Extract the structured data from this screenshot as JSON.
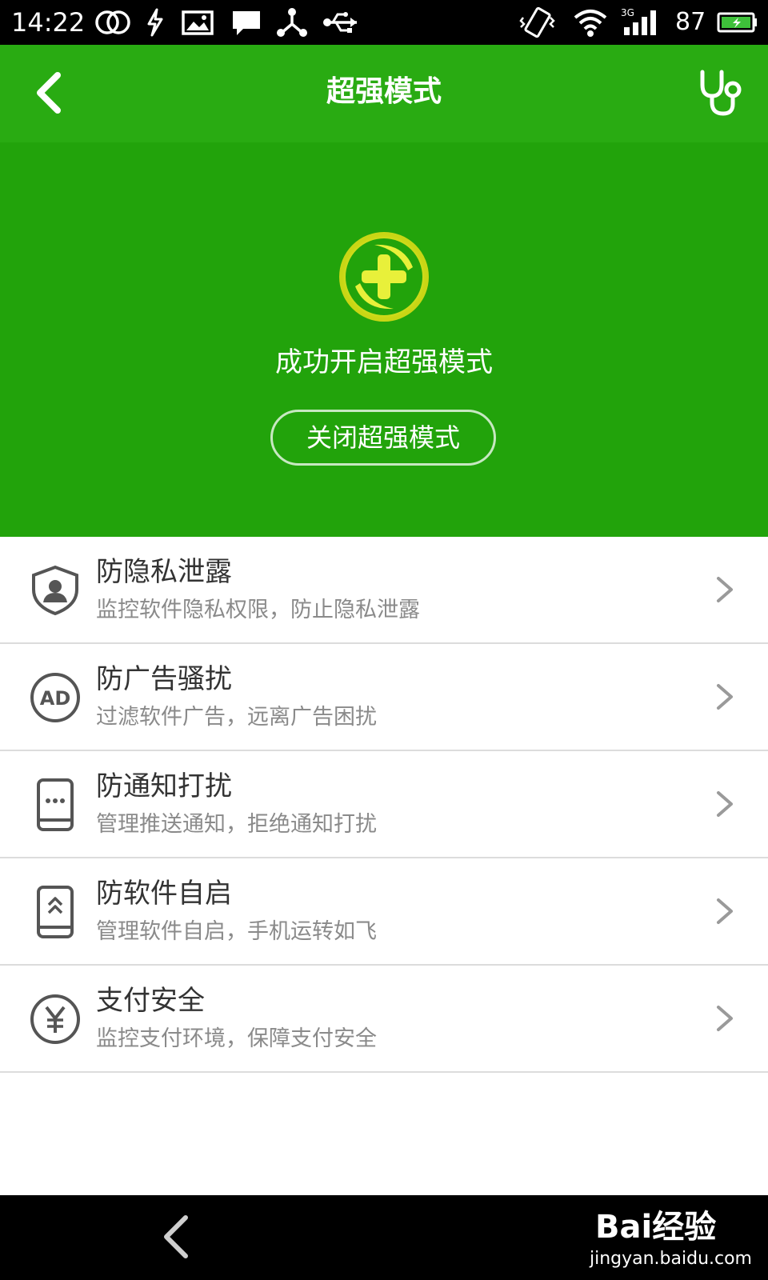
{
  "status_bar": {
    "time": "14:22",
    "battery_percent": "87",
    "icons": [
      "circles-icon",
      "bolt-icon",
      "image-icon",
      "message-icon",
      "share-icon",
      "usb-icon",
      "vibrate-icon",
      "wifi-icon",
      "signal-3g-icon",
      "battery-icon"
    ],
    "network_label": "3G"
  },
  "app_bar": {
    "title": "超强模式",
    "back_icon": "back-chevron-icon",
    "action_icon": "stethoscope-icon"
  },
  "hero": {
    "logo_icon": "plus-shield-logo",
    "status_text": "成功开启超强模式",
    "button_label": "关闭超强模式"
  },
  "features": [
    {
      "icon": "shield-user-icon",
      "title": "防隐私泄露",
      "subtitle": "监控软件隐私权限，防止隐私泄露"
    },
    {
      "icon": "ad-icon",
      "title": "防广告骚扰",
      "subtitle": "过滤软件广告，远离广告困扰"
    },
    {
      "icon": "phone-notify-icon",
      "title": "防通知打扰",
      "subtitle": "管理推送通知，拒绝通知打扰"
    },
    {
      "icon": "phone-autostart-icon",
      "title": "防软件自启",
      "subtitle": "管理软件自启，手机运转如飞"
    },
    {
      "icon": "yuan-icon",
      "title": "支付安全",
      "subtitle": "监控支付环境，保障支付安全"
    }
  ],
  "nav_bar": {
    "back_icon": "nav-back-icon"
  },
  "watermark": {
    "brand": "Bai经验",
    "url": "jingyan.baidu.com"
  },
  "colors": {
    "app_bar": "#29ab12",
    "hero": "#22a30b",
    "logo_yellow": "#e8f03a"
  }
}
